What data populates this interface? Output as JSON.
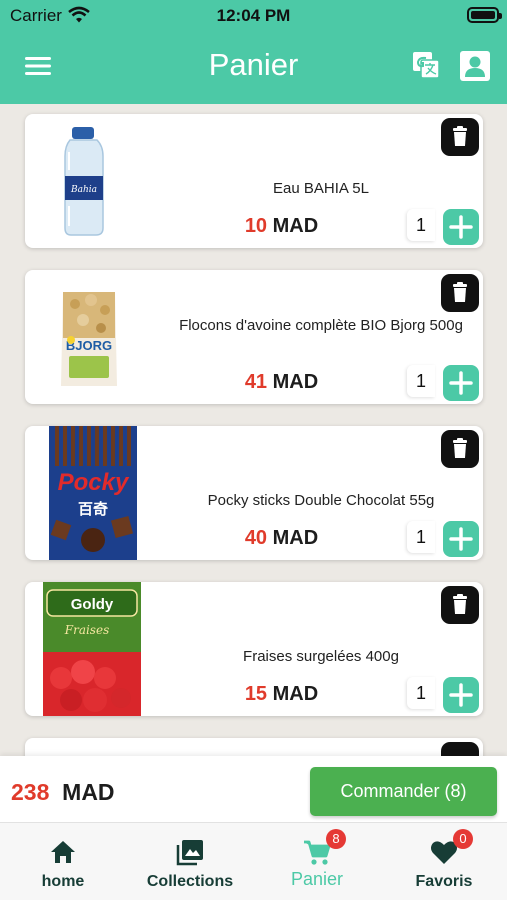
{
  "status_bar": {
    "carrier": "Carrier",
    "time": "12:04 PM"
  },
  "header": {
    "title": "Panier"
  },
  "cart": {
    "items": [
      {
        "name": "Eau BAHIA 5L",
        "price": "10",
        "currency": "MAD",
        "quantity": "1"
      },
      {
        "name": "Flocons d'avoine complète BIO Bjorg 500g",
        "price": "41",
        "currency": "MAD",
        "quantity": "1"
      },
      {
        "name": "Pocky sticks Double Chocolat 55g",
        "price": "40",
        "currency": "MAD",
        "quantity": "1"
      },
      {
        "name": "Fraises surgelées 400g",
        "price": "15",
        "currency": "MAD",
        "quantity": "1"
      }
    ]
  },
  "footer": {
    "total": "238",
    "currency": "MAD",
    "order_button": "Commander (8)"
  },
  "tabs": [
    {
      "label": "home",
      "icon": "home-icon"
    },
    {
      "label": "Collections",
      "icon": "collections-icon"
    },
    {
      "label": "Panier",
      "icon": "cart-icon",
      "badge": "8"
    },
    {
      "label": "Favoris",
      "icon": "heart-icon",
      "badge": "0"
    }
  ],
  "colors": {
    "accent": "#4cc9a6",
    "price_red": "#e03b2b",
    "order_green": "#4bb050"
  }
}
